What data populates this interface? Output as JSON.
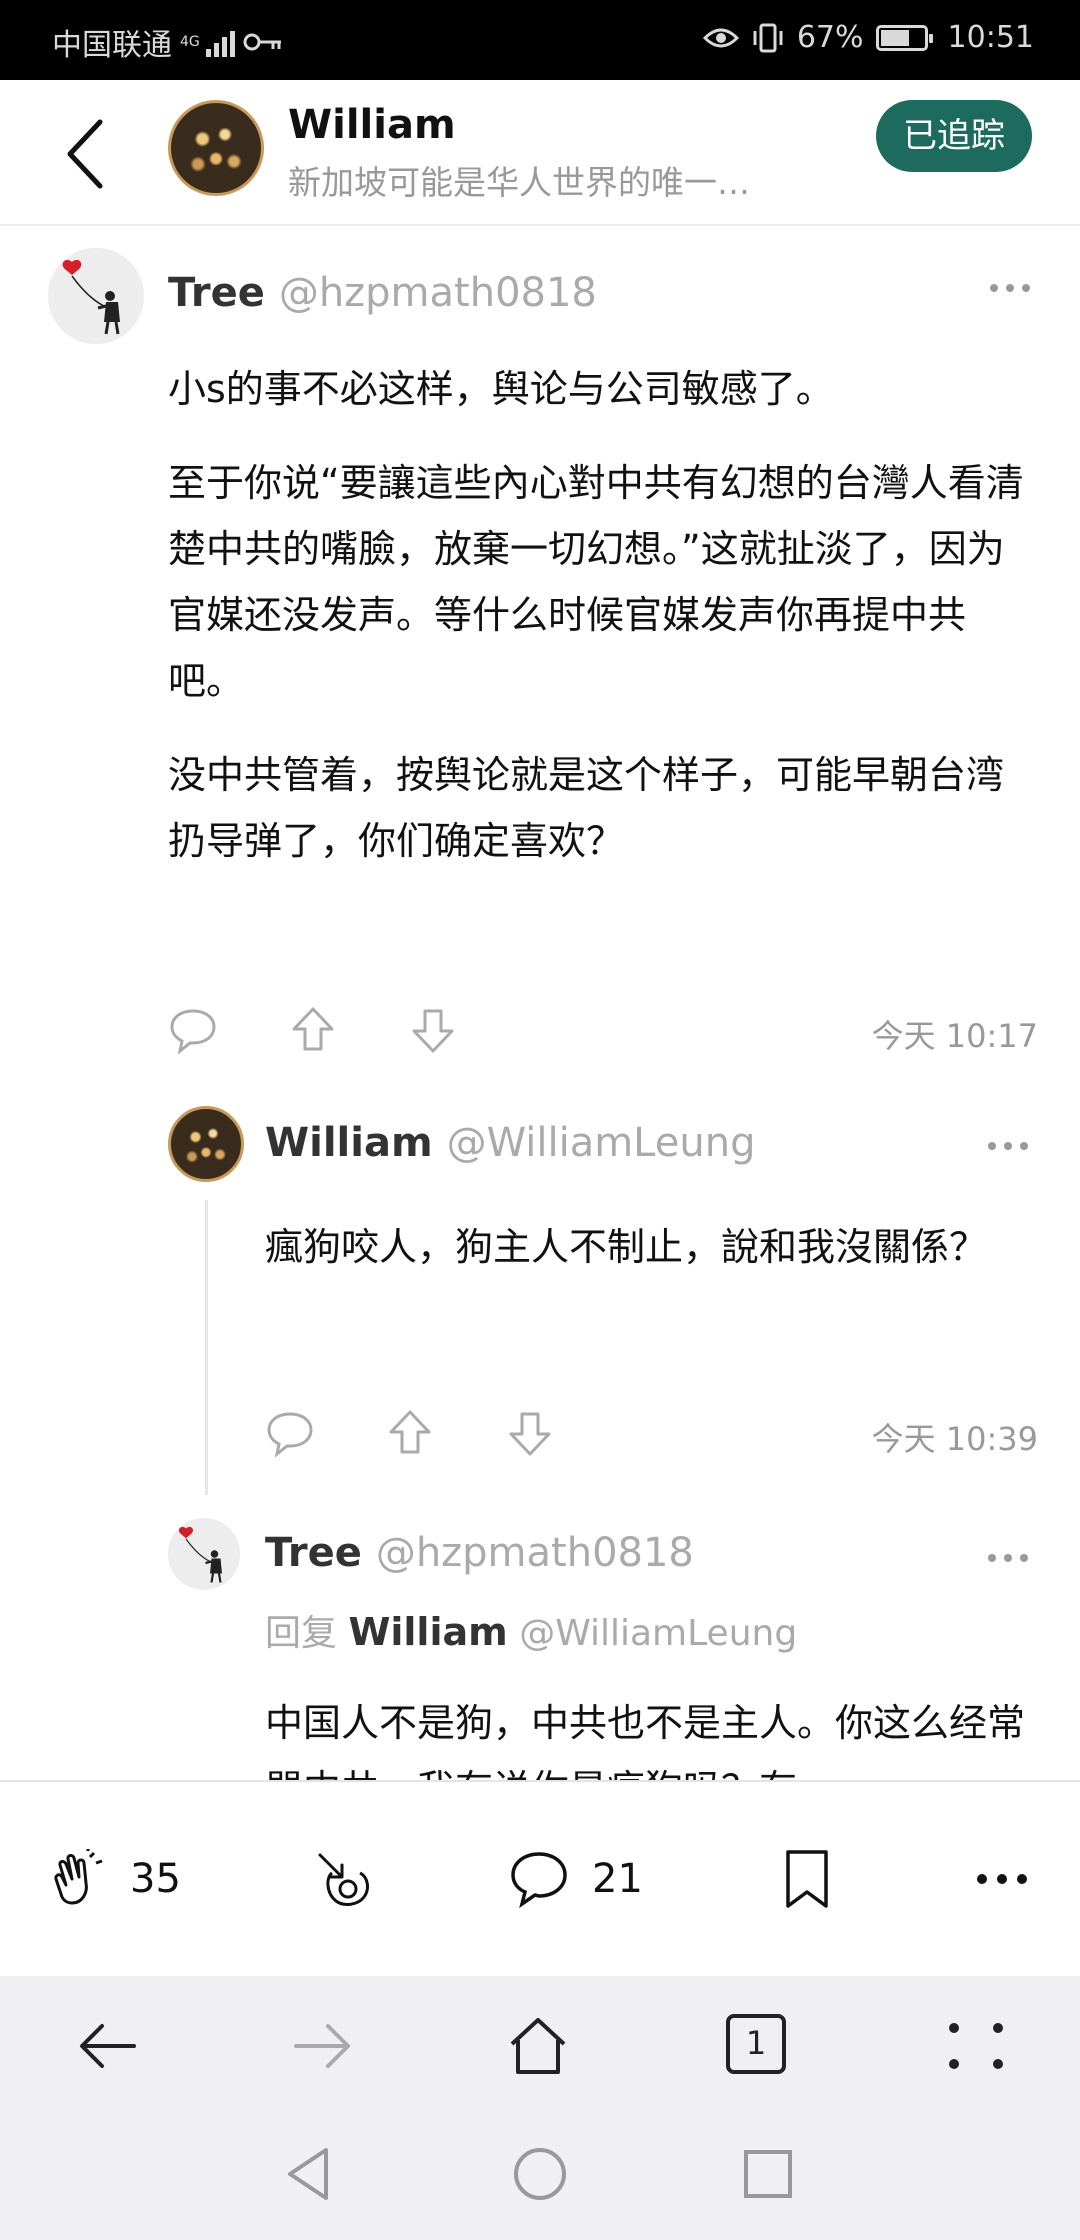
{
  "status_bar": {
    "carrier": "中国联通",
    "network": "4G",
    "battery_percent": "67%",
    "time": "10:51",
    "battery_level": 0.67
  },
  "header": {
    "name": "William",
    "subtitle": "新加坡可能是华人世界的唯一…",
    "follow_label": "已追踪"
  },
  "posts": [
    {
      "author": "Tree",
      "handle": "@hzpmath0818",
      "paragraphs": [
        "小s的事不必这样，舆论与公司敏感了。",
        "至于你说“要讓這些內心對中共有幻想的台灣人看清楚中共的嘴臉，放棄一切幻想。”这就扯淡了，因为官媒还没发声。等什么时候官媒发声你再提中共吧。",
        "没中共管着，按舆论就是这个样子，可能早朝台湾扔导弹了，你们确定喜欢？"
      ],
      "timestamp": "今天 10:17"
    },
    {
      "author": "William",
      "handle": "@WilliamLeung",
      "paragraphs": [
        "瘋狗咬人，狗主人不制止，說和我沒關係？"
      ],
      "timestamp": "今天 10:39"
    },
    {
      "author": "Tree",
      "handle": "@hzpmath0818",
      "reply_prefix": "回复",
      "reply_to_name": "William",
      "reply_to_handle": "@WilliamLeung",
      "paragraphs": [
        "中国人不是狗，中共也不是主人。你这么经常骂中共，我有说你是疯狗吗？有"
      ]
    }
  ],
  "bottom_bar": {
    "clap_count": "35",
    "comment_count": "21"
  },
  "browser_nav": {
    "tab_count": "1"
  }
}
